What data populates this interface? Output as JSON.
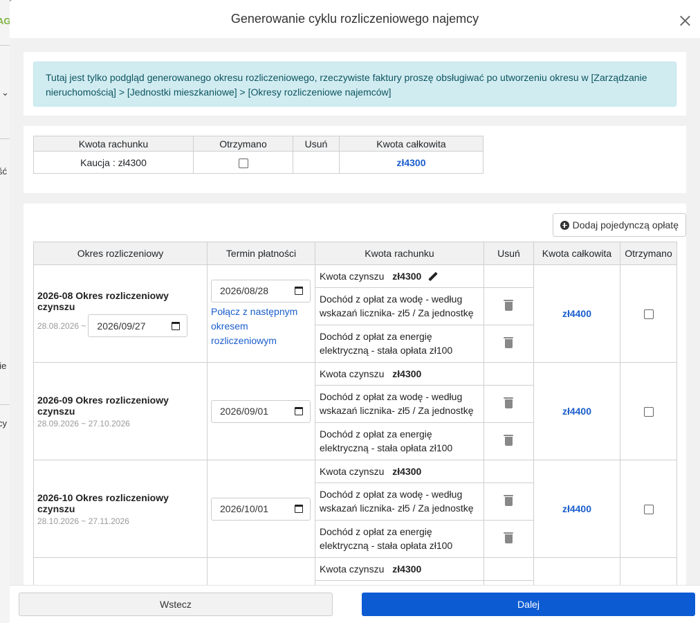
{
  "background": {
    "fragments": [
      "AG",
      "ść",
      "nie",
      "cy"
    ]
  },
  "modal": {
    "title": "Generowanie cyklu rozliczeniowego najemcy"
  },
  "alert": {
    "text": "Tutaj jest tylko podgląd generowanego okresu rozliczeniowego, rzeczywiste faktury proszę obsługiwać po utworzeniu okresu w [Zarządzanie nieruchomością] > [Jednostki mieszkaniowe] > [Okresy rozliczeniowe najemców]"
  },
  "deposit_table": {
    "headers": [
      "Kwota rachunku",
      "Otrzymano",
      "Usuń",
      "Kwota całkowita"
    ],
    "row": {
      "bill": "Kaucja : zł4300",
      "total": "zł4300"
    }
  },
  "add_fee_button": "Dodaj pojedynczą opłatę",
  "periods_table": {
    "headers": [
      "Okres rozliczeniowy",
      "Termin płatności",
      "Kwota rachunku",
      "Usuń",
      "Kwota całkowita",
      "Otrzymano"
    ],
    "rows": [
      {
        "title": "2026-08 Okres rozliczeniowy czynszu",
        "range_start": "28.08.2026 ~",
        "range_end_input": "2026/09/27",
        "due_date": "2026/08/28",
        "link": "Połącz z następnym okresem rozliczeniowym",
        "rent_label": "Kwota czynszu",
        "rent_amount": "zł4300",
        "water": "Dochód z opłat za wodę - według wskazań licznika- zł5 / Za jednostkę",
        "power": "Dochód z opłat za energię elektryczną - stała opłata zł100",
        "total": "zł4400"
      },
      {
        "title": "2026-09 Okres rozliczeniowy czynszu",
        "range": "28.09.2026 ~ 27.10.2026",
        "due_date": "2026/09/01",
        "rent_label": "Kwota czynszu",
        "rent_amount": "zł4300",
        "water": "Dochód z opłat za wodę - według wskazań licznika- zł5 / Za jednostkę",
        "power": "Dochód z opłat za energię elektryczną - stała opłata zł100",
        "total": "zł4400"
      },
      {
        "title": "2026-10 Okres rozliczeniowy czynszu",
        "range": "28.10.2026 ~ 27.11.2026",
        "due_date": "2026/10/01",
        "rent_label": "Kwota czynszu",
        "rent_amount": "zł4300",
        "water": "Dochód z opłat za wodę - według wskazań licznika- zł5 / Za jednostkę",
        "power": "Dochód z opłat za energię elektryczną - stała opłata zł100",
        "total": "zł4400"
      },
      {
        "rent_label": "Kwota czynszu",
        "rent_amount": "zł4300"
      }
    ]
  },
  "footer": {
    "back": "Wstecz",
    "next": "Dalej"
  },
  "colors": {
    "accent": "#0d5bd3",
    "link": "#1a5dcc",
    "alert_bg": "#d1ecf1",
    "alert_text": "#0c5460"
  }
}
